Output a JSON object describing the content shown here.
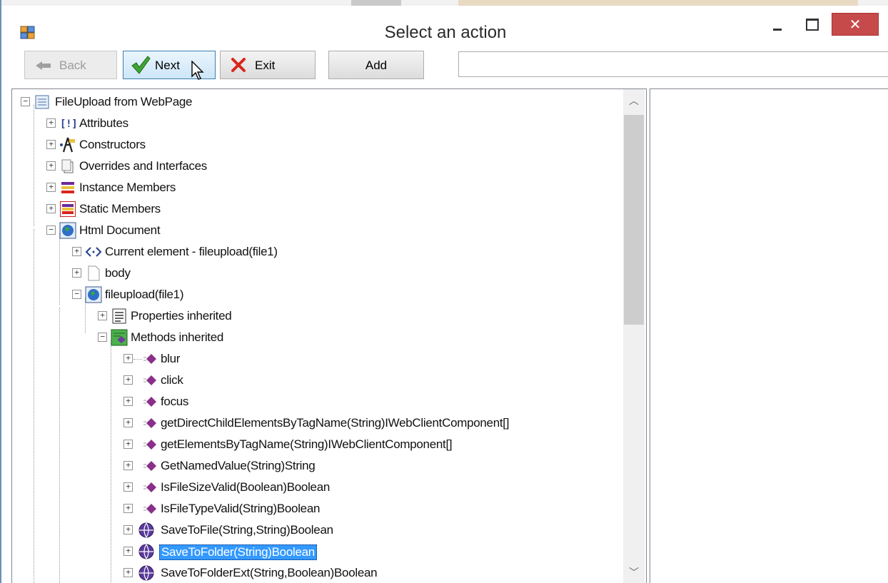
{
  "window": {
    "title": "Select an action"
  },
  "toolbar": {
    "back_label": "Back",
    "next_label": "Next",
    "exit_label": "Exit",
    "add_label": "Add",
    "search_value": ""
  },
  "tree": {
    "root": "FileUpload from WebPage",
    "attributes": "Attributes",
    "constructors": "Constructors",
    "overrides": "Overrides and Interfaces",
    "instance_members": "Instance Members",
    "static_members": "Static Members",
    "html_document": "Html Document",
    "current_element": "Current element - fileupload(file1)",
    "body": "body",
    "fileupload": "fileupload(file1)",
    "properties_inherited": "Properties inherited",
    "methods_inherited": "Methods inherited",
    "methods": [
      "blur",
      "click",
      "focus",
      "getDirectChildElementsByTagName(String)IWebClientComponent[]",
      "getElementsByTagName(String)IWebClientComponent[]",
      "GetNamedValue(String)String",
      "IsFileSizeValid(Boolean)Boolean",
      "IsFileTypeValid(String)Boolean",
      "SaveToFile(String,String)Boolean",
      "SaveToFolder(String)Boolean",
      "SaveToFolderExt(String,Boolean)Boolean"
    ],
    "selected_item": "SaveToFolder(String)Boolean"
  },
  "colors": {
    "selection": "#3399ff",
    "close_button": "#c74a4a",
    "next_border": "#3c7fb1"
  }
}
